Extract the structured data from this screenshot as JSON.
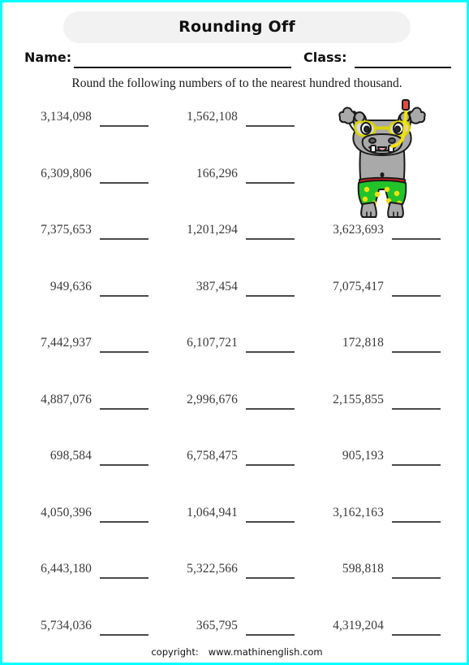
{
  "page": {
    "border_color": "#00ffff",
    "background": "#ffffff"
  },
  "header": {
    "title": "Rounding Off",
    "title_pill_color": "#f2f2f2"
  },
  "fields": {
    "name_label": "Name:",
    "class_label": "Class:"
  },
  "instruction": "Round the following numbers of to the nearest hundred thousand.",
  "illustration": {
    "name": "hippo-snorkeler",
    "body_color": "#a9a9a9",
    "trunks_color": "#22c32a",
    "dots_color": "#f2e10c",
    "waistband_color": "#e81f1f",
    "goggles_color": "#e8e80c",
    "snorkel_color": "#f2e10c",
    "outline_color": "#1a1a1a"
  },
  "problems": {
    "blank_placeholder": "",
    "rows": [
      {
        "c1": "3,134,098",
        "c2": "1,562,108",
        "c3": null
      },
      {
        "c1": "6,309,806",
        "c2": "166,296",
        "c3": null
      },
      {
        "c1": "7,375,653",
        "c2": "1,201,294",
        "c3": "3,623,693"
      },
      {
        "c1": "949,636",
        "c2": "387,454",
        "c3": "7,075,417"
      },
      {
        "c1": "7,442,937",
        "c2": "6,107,721",
        "c3": "172,818"
      },
      {
        "c1": "4,887,076",
        "c2": "2,996,676",
        "c3": "2,155,855"
      },
      {
        "c1": "698,584",
        "c2": "6,758,475",
        "c3": "905,193"
      },
      {
        "c1": "4,050,396",
        "c2": "1,064,941",
        "c3": "3,162,163"
      },
      {
        "c1": "6,443,180",
        "c2": "5,322,566",
        "c3": "598,818"
      },
      {
        "c1": "5,734,036",
        "c2": "365,795",
        "c3": "4,319,204"
      }
    ]
  },
  "footer": {
    "copyright_label": "copyright:",
    "site": "www.mathinenglish.com"
  }
}
